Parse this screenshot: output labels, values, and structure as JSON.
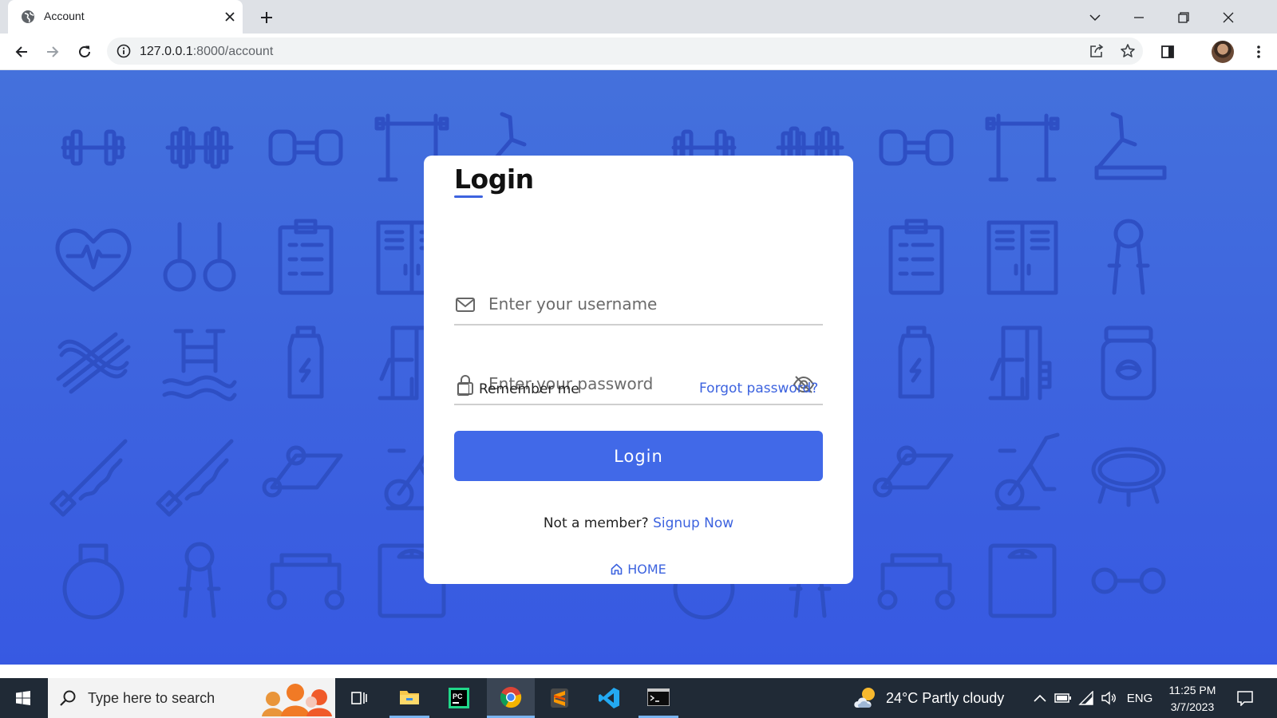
{
  "browser": {
    "tab_title": "Account",
    "url_host": "127.0.0.1",
    "url_path": ":8000/account"
  },
  "login": {
    "title": "Login",
    "username_placeholder": "Enter your username",
    "password_placeholder": "Enter your password",
    "remember_label": "Remember me",
    "forgot_label": "Forgot password?",
    "button_label": "Login",
    "signup_prompt": "Not a member?",
    "signup_link": "Signup Now",
    "home_label": "HOME"
  },
  "taskbar": {
    "search_placeholder": "Type here to search",
    "weather": "24°C  Partly cloudy",
    "language": "ENG",
    "time": "11:25 PM",
    "date": "3/7/2023"
  },
  "colors": {
    "page_background": "#3d63df",
    "accent": "#4169e8",
    "link": "#3d63df",
    "taskbar": "#202a36"
  },
  "icons": [
    "globe-icon",
    "close-icon",
    "plus-icon",
    "chevron-down-icon",
    "minimize-icon",
    "restore-icon",
    "back-icon",
    "forward-icon",
    "reload-icon",
    "info-icon",
    "share-icon",
    "star-icon",
    "side-panel-icon",
    "kebab-menu-icon",
    "envelope-icon",
    "lock-icon",
    "eye-off-icon",
    "house-icon",
    "windows-start-icon",
    "search-icon",
    "task-view-icon",
    "file-explorer-icon",
    "pycharm-icon",
    "chrome-icon",
    "sublime-icon",
    "vscode-icon",
    "terminal-icon",
    "weather-icon",
    "battery-icon",
    "wifi-icon",
    "volume-icon",
    "notification-icon"
  ]
}
